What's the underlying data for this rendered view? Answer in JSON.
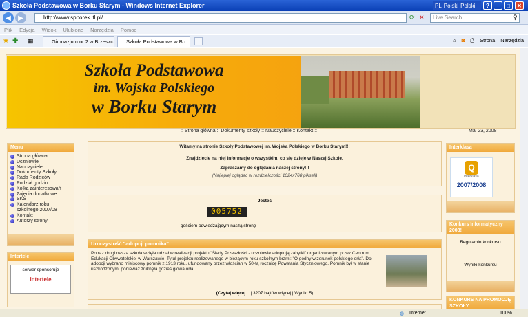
{
  "window": {
    "title": "Szkoła Podstawowa w Borku Starym - Windows Internet Explorer",
    "lang_code": "PL",
    "lang_name": "Polski",
    "lang_name2": "Polski",
    "help": "?"
  },
  "address": {
    "url": "http://www.spborek.itl.pl/",
    "search_placeholder": "Live Search"
  },
  "menu": [
    "Plik",
    "Edycja",
    "Widok",
    "Ulubione",
    "Narzędzia",
    "Pomoc"
  ],
  "tabs": [
    {
      "label": "Gimnazjum nr 2 w Brzeszczach"
    },
    {
      "label": "Szkoła Podstawowa w Bo..."
    }
  ],
  "toolbar": {
    "page_label": "Strona",
    "tools_label": "Narzędzia"
  },
  "banner": {
    "line1": "Szkoła Podstawowa",
    "line2": "im. Wojska Polskiego",
    "line3": "w Borku Starym"
  },
  "topnav": [
    "Strona główna",
    "Dokumenty szkoły",
    "Nauczyciele",
    "Kontakt"
  ],
  "date": "Maj 23, 2008",
  "left_menu": {
    "title": "Menu",
    "items": [
      "Strona główna",
      "Uczniowie",
      "Nauczyciele",
      "Dokumenty Szkoły",
      "Rada Rodziców",
      "Podział godzin",
      "Kółka zainteresowań",
      "Zajęcia dodatkowe",
      "SKS",
      "Kalendarz roku szkolnego 2007/08",
      "Kontakt",
      "Autorzy strony"
    ]
  },
  "intertele": {
    "title": "Intertele",
    "sponsor": "serwer sponsoruje",
    "logo": "intertele"
  },
  "welcome": {
    "l1": "Witamy na stronie Szkoły Podstawowej im. Wojska Polskiego w Borku Starym!!!",
    "l2": "Znajdziecie na niej informacje o wszystkim, co się dzieje w Naszej Szkole.",
    "l3": "Zapraszamy do oglądania naszej strony!!!",
    "l4": "(Najlepiej oglądać w rozdzielczości 1024x768 pikseli)"
  },
  "counter": {
    "title": "Jesteś",
    "value": "005752",
    "text": "gościem odwiedzającym naszą stronę"
  },
  "article": {
    "title": "Uroczystość \"adopcji pomnika\"",
    "body": "Po raz drugi nasza szkoła wzięła udział w realizacji projektu \"Ślady Przeszłości - uczniowie adoptują zabytki\" organizowanym przez Centrum Edukacji Obywatelskiej w Warszawie. Tytuł projektu realizowanego w bieżącym roku szkolnym brzmi: \"O godny wizerunek polskiego orła\". Do adopcji wybrano miejscowy pomnik z 1913 roku, ufundowany przez włościan w 50-tą rocznicę Powstania Styczniowego. Pomnik był w stanie uszkodzonym, ponieważ zniknęła gdzieś głowa orła...",
    "read_more": "(Czytaj więcej...",
    "meta": "| 3207 bajtów więcej | Wynik: 5)"
  },
  "interklasa": {
    "title": "Interklasa",
    "badge_year": "2007/2008",
    "badge_text": "interklasa"
  },
  "konkurs": {
    "title": "Konkurs Informatyczny 2008!",
    "link1": "Regulamin konkursu",
    "link2": "Wyniki konkursu"
  },
  "konkurs2": {
    "title": "KONKURS NA PROMOCJĘ SZKOŁY"
  },
  "status": {
    "zone": "Internet",
    "zoom": "100%"
  }
}
